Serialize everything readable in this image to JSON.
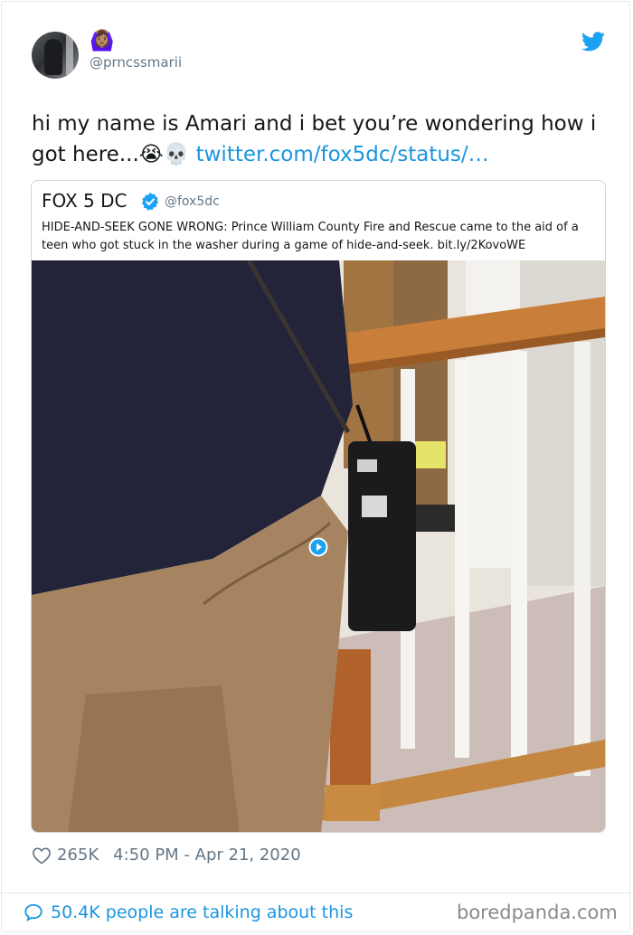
{
  "tweet": {
    "user_emoji": "🙆🏽‍♀️",
    "handle": "@prncssmarii",
    "text": "hi my name is Amari and i bet you’re wondering how i got here...",
    "text_emojis": "😭💀",
    "link": "twitter.com/fox5dc/status/…",
    "likes": "265K",
    "timestamp": "4:50 PM - Apr 21, 2020",
    "talking": "50.4K people are talking about this"
  },
  "quoted": {
    "name": "FOX 5 DC",
    "handle": "@fox5dc",
    "text": "HIDE-AND-SEEK GONE WRONG: Prince William County Fire and Rescue came to the aid of a teen who got stuck in the washer during a game of hide-and-seek. bit.ly/2KovoWE"
  },
  "watermark": "boredpanda.com",
  "colors": {
    "twitter_blue": "#1b95e0",
    "text_primary": "#14171a",
    "text_secondary": "#657786",
    "border": "#e1e8ed"
  },
  "icons": [
    "twitter-bird-icon",
    "verified-badge-icon",
    "play-icon",
    "heart-icon",
    "speech-bubble-icon"
  ]
}
